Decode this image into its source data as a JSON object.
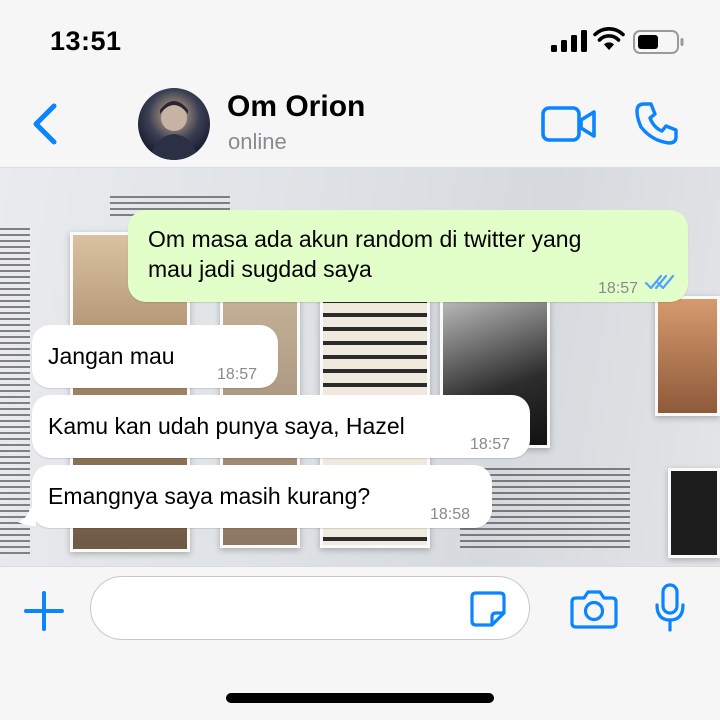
{
  "status_bar": {
    "time": "13:51",
    "icons": [
      "signal-icon",
      "wifi-icon",
      "battery-icon"
    ]
  },
  "header": {
    "contact_name": "Om Orion",
    "contact_status": "online",
    "icons": [
      "back-icon",
      "video-call-icon",
      "phone-icon"
    ]
  },
  "messages": [
    {
      "direction": "outgoing",
      "lines": [
        "Om masa ada akun random di twitter yang",
        "mau jadi sugdad saya"
      ],
      "time": "18:57",
      "status": "read"
    },
    {
      "direction": "incoming",
      "text": "Jangan mau",
      "time": "18:57"
    },
    {
      "direction": "incoming",
      "text": "Kamu kan udah punya saya, Hazel",
      "time": "18:57"
    },
    {
      "direction": "incoming",
      "text": "Emangnya saya masih kurang?",
      "time": "18:58"
    }
  ],
  "input_bar": {
    "placeholder": "",
    "icons": [
      "plus-icon",
      "sticker-icon",
      "camera-icon",
      "microphone-icon"
    ]
  },
  "colors": {
    "accent": "#0a84ff",
    "outgoing_bubble": "#e2fec9",
    "incoming_bubble": "#ffffff",
    "read_ticks": "#4fa3f7"
  }
}
